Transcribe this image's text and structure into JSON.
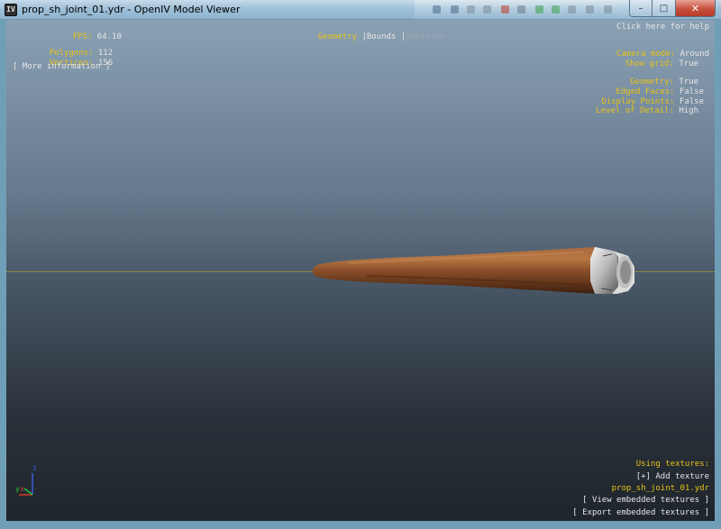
{
  "window": {
    "title": "prop_sh_joint_01.ydr - OpenIV Model Viewer",
    "app_icon": "IV",
    "min_glyph": "–",
    "max_glyph": "□",
    "close_glyph": "✕"
  },
  "stats": {
    "fps_label": "FPS:",
    "fps_value": "64.10",
    "polygons_label": "Polygons:",
    "polygons_value": "112",
    "vertices_label": "Vertices:",
    "vertices_value": "156",
    "more_info": "[ More information ]"
  },
  "view_tabs": {
    "geometry": "Geometry",
    "sep1": "|",
    "bounds": "Bounds",
    "sep2": "|",
    "skeleton": "Skeleton"
  },
  "help": "Click here for help",
  "settings": {
    "camera_mode_label": "Camera mode:",
    "camera_mode_value": "Around",
    "show_grid_label": "Show grid:",
    "show_grid_value": "True",
    "geometry_label": "Geometry:",
    "geometry_value": "True",
    "edged_faces_label": "Edged Faces:",
    "edged_faces_value": "False",
    "display_points_label": "Display Points:",
    "display_points_value": "False",
    "lod_label": "Level of Detail:",
    "lod_value": "High"
  },
  "textures": {
    "heading": "Using textures:",
    "add": "[+] Add texture",
    "file": "prop_sh_joint_01.ydr",
    "view_embedded": "[ View embedded textures ]",
    "export_embedded": "[ Export embedded textures ]"
  },
  "axis": {
    "z": "z",
    "y": "y",
    "x": "x"
  },
  "colors": {
    "label_yellow": "#e8c418",
    "value_white": "#e6e6e6",
    "disabled_gray": "#9aa6b2",
    "axis_x": "#d23a2a",
    "axis_y": "#2fbf3a",
    "axis_z": "#3a5ee0"
  }
}
